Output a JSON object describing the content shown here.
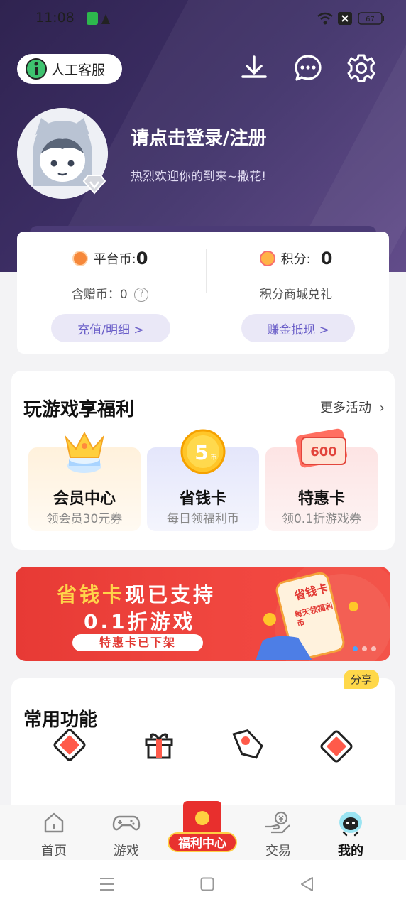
{
  "status_bar": {
    "time": "11:08",
    "battery": "67"
  },
  "header": {
    "service_label": "人工客服",
    "login_title": "请点击登录/注册",
    "login_subtitle": "热烈欢迎你的到来~撒花!"
  },
  "wallet": {
    "platform_coin_label": "平台币:",
    "platform_coin_value": "0",
    "gift_coin_label": "含赠币：0",
    "recharge_button": "充值/明细 >",
    "points_label": "积分:",
    "points_value": "0",
    "points_sub": "积分商城兑礼",
    "earn_button": "赚金抵现 >"
  },
  "benefits": {
    "title": "玩游戏享福利",
    "more": "更多活动",
    "tiles": [
      {
        "title": "会员中心",
        "subtitle": "领会员30元券"
      },
      {
        "title": "省钱卡",
        "subtitle": "每日领福利币",
        "badge": "5币"
      },
      {
        "title": "特惠卡",
        "subtitle": "领0.1折游戏券",
        "badge": "600元"
      }
    ]
  },
  "banner": {
    "line1_highlight": "省钱卡",
    "line1_rest": "现已支持",
    "line2": "0.1折游戏",
    "line3": "特惠卡已下架",
    "card_text": "省钱卡",
    "card_sub": "每天领福利币"
  },
  "functions": {
    "title": "常用功能",
    "share_badge": "分享"
  },
  "tabbar": {
    "home": "首页",
    "games": "游戏",
    "welfare": "福利中心",
    "trade": "交易",
    "mine": "我的"
  },
  "colors": {
    "accent": "#6a5ec8",
    "hero": "#3a2c62",
    "banner": "#ee4340",
    "badge": "#ffd84a"
  }
}
